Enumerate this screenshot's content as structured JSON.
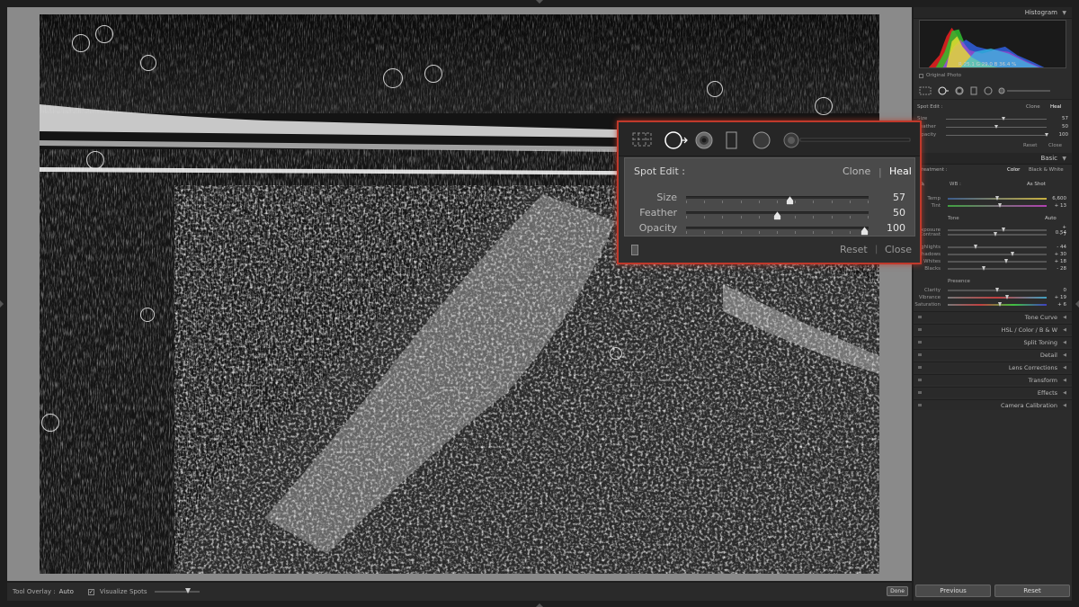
{
  "histogram": {
    "title": "Histogram",
    "readout": "R  25.1  G  29.0  B  36.4 %",
    "original_photo_label": "Original Photo"
  },
  "mini_spot": {
    "title": "Spot Edit :",
    "clone": "Clone",
    "heal": "Heal",
    "rows": [
      {
        "name": "Size",
        "value": "57",
        "level": 0.57
      },
      {
        "name": "Feather",
        "value": "50",
        "level": 0.5
      },
      {
        "name": "Opacity",
        "value": "100",
        "level": 1.0
      }
    ],
    "reset": "Reset",
    "close": "Close"
  },
  "basic": {
    "title": "Basic",
    "treatment": "Treatment :",
    "color": "Color",
    "bw": "Black & White",
    "wb": "WB :",
    "wb_value": "As Shot",
    "tone": "Tone",
    "auto": "Auto",
    "presence": "Presence",
    "rows": [
      {
        "name": "Temp",
        "value": "6,600",
        "level": 0.5
      },
      {
        "name": "Tint",
        "value": "+ 13",
        "level": 0.53
      },
      {
        "name": "Exposure",
        "value": "+ 0.54",
        "level": 0.56
      },
      {
        "name": "Contrast",
        "value": "- 7",
        "level": 0.48
      },
      {
        "name": "Highlights",
        "value": "- 44",
        "level": 0.28
      },
      {
        "name": "Shadows",
        "value": "+ 30",
        "level": 0.65
      },
      {
        "name": "Whites",
        "value": "+ 18",
        "level": 0.59
      },
      {
        "name": "Blacks",
        "value": "- 28",
        "level": 0.36
      },
      {
        "name": "Clarity",
        "value": "0",
        "level": 0.5
      },
      {
        "name": "Vibrance",
        "value": "+ 19",
        "level": 0.6
      },
      {
        "name": "Saturation",
        "value": "+ 6",
        "level": 0.53
      }
    ]
  },
  "sections": [
    "Tone Curve",
    "HSL  /  Color  /  B & W",
    "Split Toning",
    "Detail",
    "Lens Corrections",
    "Transform",
    "Effects",
    "Camera Calibration"
  ],
  "panel_buttons": {
    "previous": "Previous",
    "reset": "Reset"
  },
  "toolbar": {
    "tool_overlay_label": "Tool Overlay :",
    "tool_overlay_value": "Auto",
    "visualize_label": "Visualize Spots",
    "visualize_checked": "✓",
    "done": "Done"
  },
  "spot_panel": {
    "title": "Spot Edit :",
    "clone": "Clone",
    "separator": "|",
    "heal": "Heal",
    "rows": [
      {
        "name": "Size",
        "value": "57",
        "level": 0.57
      },
      {
        "name": "Feather",
        "value": "50",
        "level": 0.5
      },
      {
        "name": "Opacity",
        "value": "100",
        "level": 1.0
      }
    ],
    "reset": "Reset",
    "close": "Close"
  },
  "colors": {
    "highlight": "#c0392b",
    "panel_bg": "#2c2c2c"
  }
}
